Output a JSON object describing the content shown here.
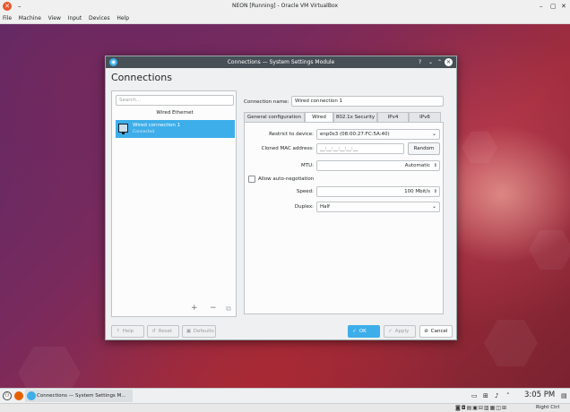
{
  "vbox": {
    "title": "NEON [Running] - Oracle VM VirtualBox",
    "minimize_glyph": "–",
    "controls": [
      "–",
      "▢",
      "✕"
    ],
    "menu": [
      "File",
      "Machine",
      "View",
      "Input",
      "Devices",
      "Help"
    ]
  },
  "dialog": {
    "title": "Connections — System Settings Module",
    "title_buttons": [
      "?",
      "⌄",
      "⌃"
    ],
    "close_glyph": "✕",
    "heading": "Connections",
    "search_placeholder": "Search...",
    "group_label": "Wired Ethernet",
    "connection": {
      "name": "Wired connection 1",
      "status": "Connected"
    },
    "list_buttons": {
      "add": "+",
      "remove": "−",
      "copy": "⧉"
    },
    "connection_name_label": "Connection name:",
    "connection_name_value": "Wired connection 1",
    "tabs": [
      "General configuration",
      "Wired",
      "802.1x Security",
      "IPv4",
      "IPv6"
    ],
    "active_tab": "Wired",
    "wired": {
      "restrict_label": "Restrict to device:",
      "restrict_value": "enp0s3 (08:00:27:FC:5A:40)",
      "mac_label": "Cloned MAC address:",
      "mac_value": "__:__:__:__:__:__",
      "random_button": "Random",
      "mtu_label": "MTU:",
      "mtu_value": "Automatic",
      "auto_neg_label": "Allow auto-negotiation",
      "auto_neg_checked": false,
      "speed_label": "Speed:",
      "speed_value": "100 Mbit/s",
      "duplex_label": "Duplex:",
      "duplex_value": "Half"
    },
    "buttons": {
      "help": "Help",
      "reset": "Reset",
      "defaults": "Defaults",
      "ok": "OK",
      "apply": "Apply",
      "cancel": "Cancel"
    }
  },
  "taskbar": {
    "task_label": "Connections — System Settings M...",
    "clock": "3:05 PM",
    "host_key": "Right Ctrl"
  },
  "colors": {
    "accent": "#3daee9",
    "titlebar": "#475057"
  }
}
